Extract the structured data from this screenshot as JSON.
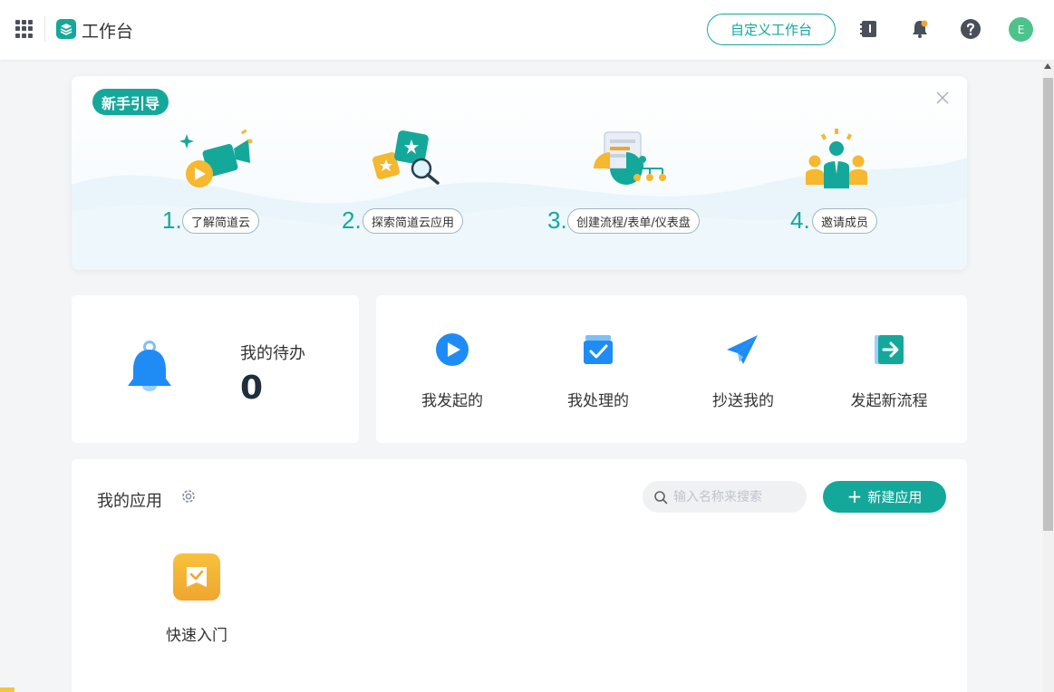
{
  "header": {
    "title": "工作台",
    "customize_label": "自定义工作台",
    "avatar_initial": "E",
    "icons": [
      "apps-grid-icon",
      "notebook-icon",
      "notification-bell-icon",
      "help-icon"
    ]
  },
  "guide": {
    "badge": "新手引导",
    "steps": [
      {
        "num": "1.",
        "label": "了解简道云"
      },
      {
        "num": "2.",
        "label": "探索简道云应用"
      },
      {
        "num": "3.",
        "label": "创建流程/表单/仪表盘"
      },
      {
        "num": "4.",
        "label": "邀请成员"
      }
    ]
  },
  "todo": {
    "label": "我的待办",
    "count": "0"
  },
  "flows": {
    "items": [
      {
        "label": "我发起的"
      },
      {
        "label": "我处理的"
      },
      {
        "label": "抄送我的"
      },
      {
        "label": "发起新流程"
      }
    ]
  },
  "apps": {
    "title": "我的应用",
    "search_placeholder": "输入名称来搜索",
    "new_label": "新建应用",
    "items": [
      {
        "label": "快速入门"
      }
    ]
  },
  "colors": {
    "accent": "#14a89b",
    "blue": "#1f8cf5",
    "yellow": "#f5b82e"
  }
}
